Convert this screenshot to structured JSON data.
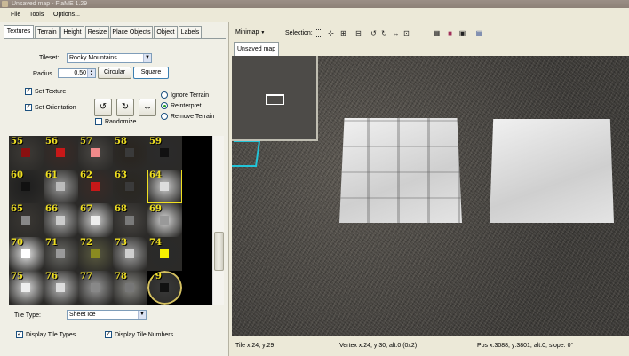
{
  "window": {
    "title": "Unsaved map - FlaME 1.29"
  },
  "menu": [
    "File",
    "Tools",
    "Options..."
  ],
  "tabs": [
    "Textures",
    "Terrain",
    "Height",
    "Resize",
    "Place Objects",
    "Object",
    "Labels"
  ],
  "textures": {
    "tileset_label": "Tileset:",
    "tileset_value": "Rocky Mountains",
    "radius_label": "Radius",
    "radius_value": "0.50",
    "circular_label": "Circular",
    "square_label": "Square",
    "set_texture_label": "Set Texture",
    "set_orientation_label": "Set Orientation",
    "randomize_label": "Randomize",
    "terrain_options": [
      "Ignore Terrain",
      "Reinterpret",
      "Remove Terrain"
    ],
    "selected_terrain_option": "Reinterpret",
    "tile_numbers": [
      "55",
      "56",
      "57",
      "58",
      "59",
      "60",
      "61",
      "62",
      "63",
      "64",
      "65",
      "66",
      "67",
      "68",
      "69",
      "70",
      "71",
      "72",
      "73",
      "74",
      "75",
      "76",
      "77",
      "78",
      "79"
    ],
    "tile_type_label": "Tile Type:",
    "tile_type_value": "Sheet Ice",
    "display_tile_types_label": "Display Tile Types",
    "display_tile_numbers_label": "Display Tile Numbers"
  },
  "toolbar": {
    "minimap_label": "Minimap",
    "selection_label": "Selection:"
  },
  "view": {
    "tab_label": "Unsaved map"
  },
  "status": {
    "tile": "Tile x:24, y:29",
    "vertex": "Vertex  x:24, y:30, alt:0 (0x2)",
    "pos": "Pos x:3088, y:3801, alt:0, slope: 0°"
  },
  "colors": {
    "tile_number": "#f0e020",
    "grass_dark": "#4a4845",
    "ice": "#e0e0e0",
    "cyan_outline": "#22c4d8"
  }
}
